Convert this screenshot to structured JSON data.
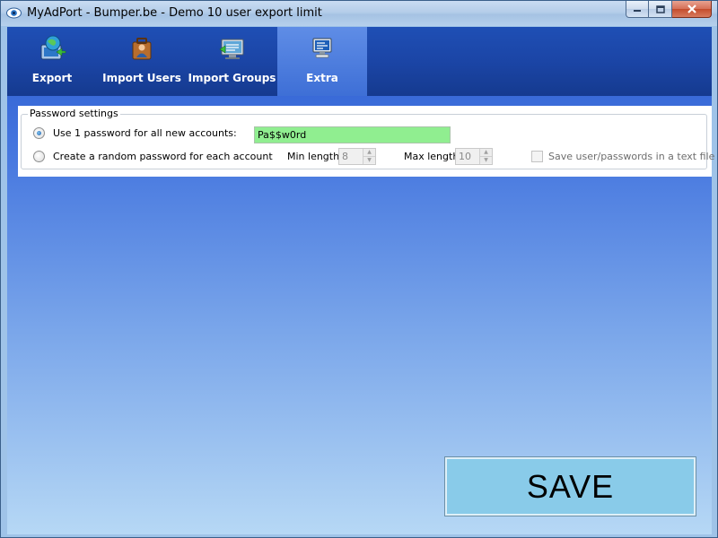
{
  "window": {
    "title": "MyAdPort - Bumper.be - Demo 10 user export limit",
    "icon": "eye-app-icon"
  },
  "tabs": [
    {
      "label": "Export",
      "icon": "globe-export-icon",
      "active": false
    },
    {
      "label": "Import Users",
      "icon": "briefcase-users-icon",
      "active": false
    },
    {
      "label": "Import Groups",
      "icon": "monitor-groups-icon",
      "active": false
    },
    {
      "label": "Extra",
      "icon": "monitor-extra-icon",
      "active": true
    }
  ],
  "password_settings": {
    "legend": "Password settings",
    "option_single": "Use 1 password for all new accounts:",
    "option_single_selected": true,
    "password_value": "Pa$$w0rd",
    "option_random": "Create a random password for each account",
    "option_random_selected": false,
    "min_length_label": "Min length",
    "min_length_value": "8",
    "max_length_label": "Max length",
    "max_length_value": "10",
    "save_text_file_label": "Save user/passwords in a text file",
    "save_text_file_checked": false
  },
  "save_button": {
    "label": "SAVE",
    "color": "#89cbe9"
  },
  "colors": {
    "password_field_bg": "#90ee90",
    "tabstrip_bg": "#1b45a6"
  }
}
